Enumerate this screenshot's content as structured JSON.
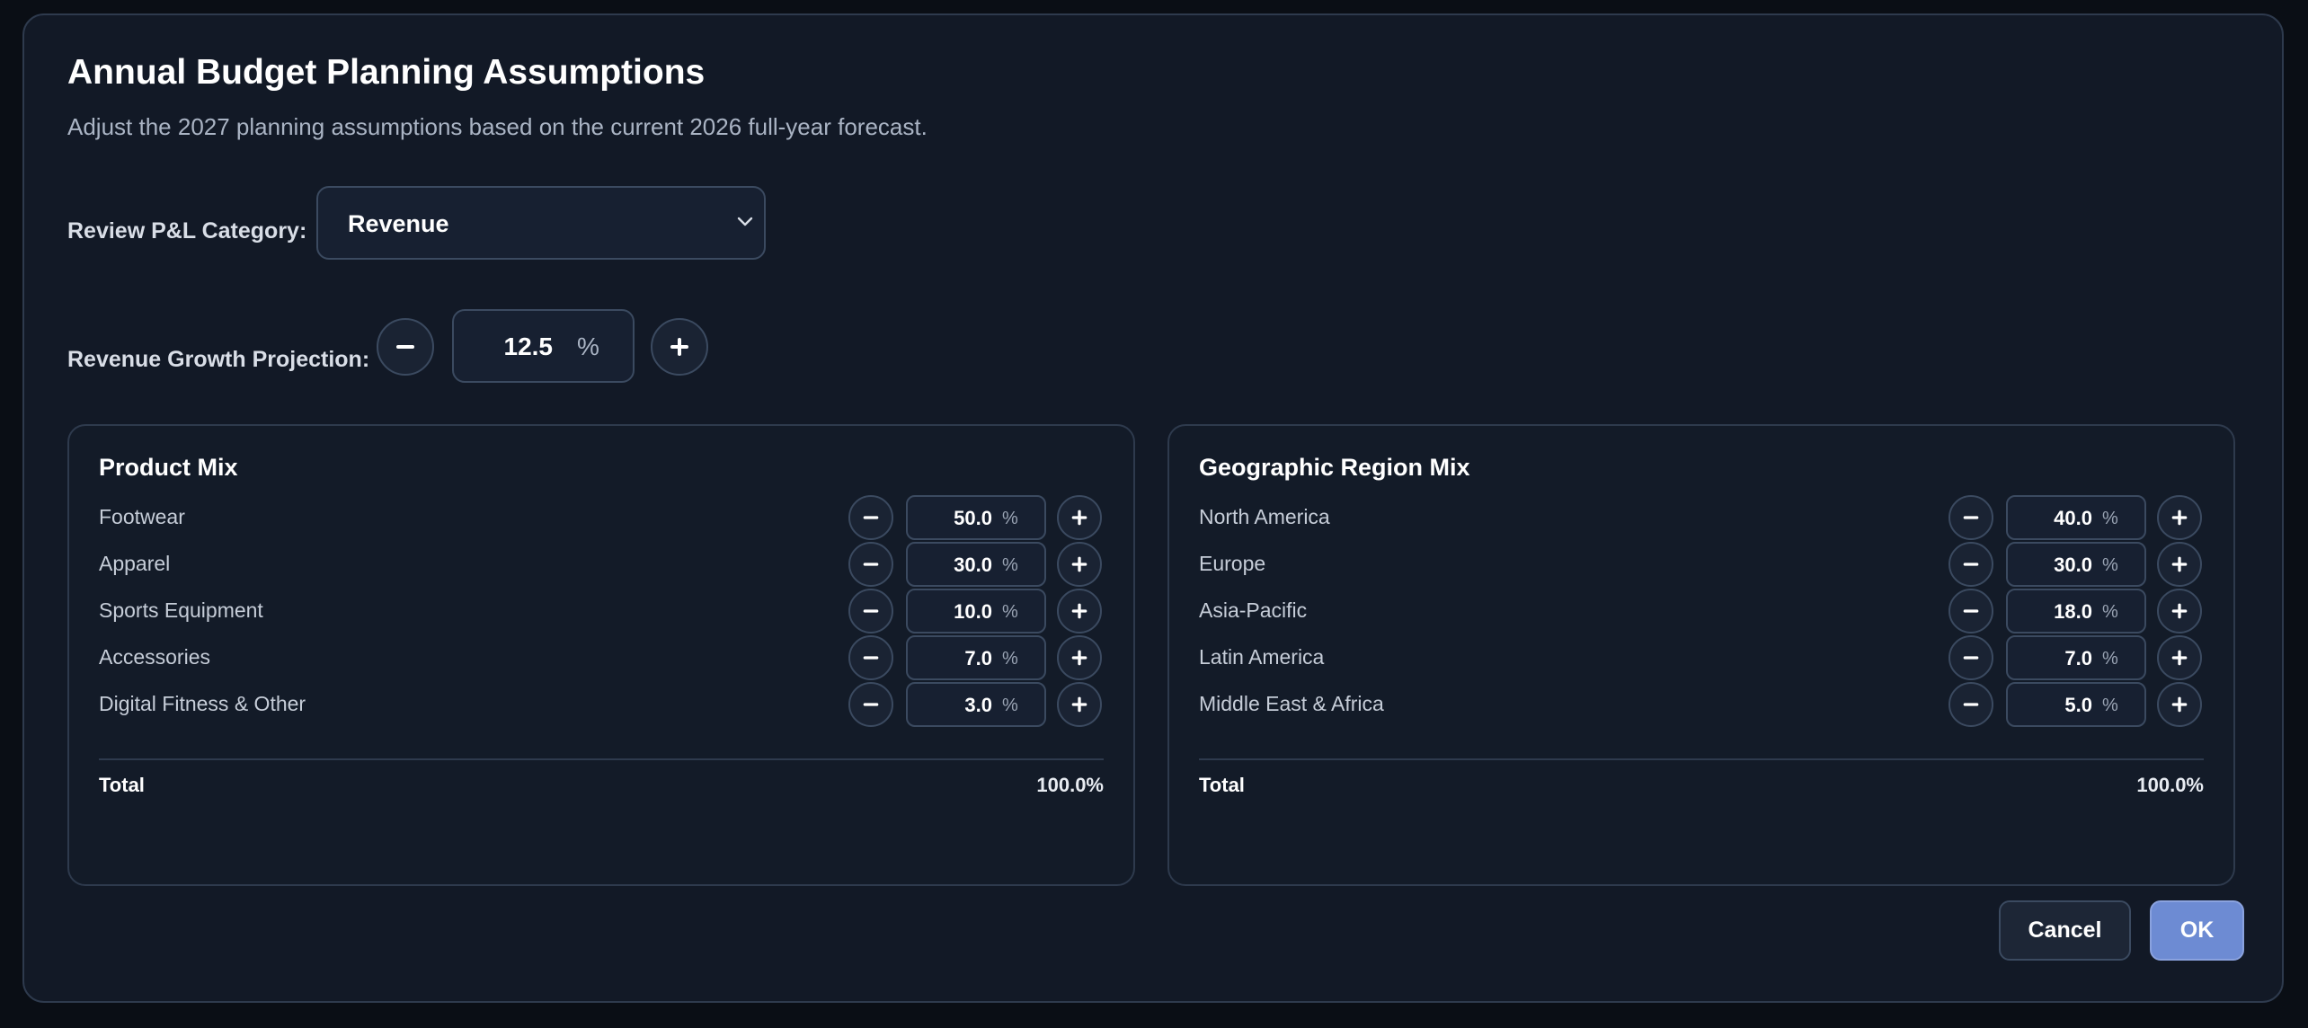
{
  "dialog": {
    "title": "Annual Budget Planning Assumptions",
    "subtitle": "Adjust the 2027 planning assumptions based on the current 2026 full-year forecast."
  },
  "category": {
    "label": "Review P&L Category:",
    "selected": "Revenue",
    "icon": "chevron-down-icon"
  },
  "growth": {
    "label": "Revenue Growth Projection:",
    "value": "12.5",
    "unit": "%"
  },
  "product_mix": {
    "title": "Product Mix",
    "rows": [
      {
        "label": "Footwear",
        "value": "50.0",
        "unit": "%"
      },
      {
        "label": "Apparel",
        "value": "30.0",
        "unit": "%"
      },
      {
        "label": "Sports Equipment",
        "value": "10.0",
        "unit": "%"
      },
      {
        "label": "Accessories",
        "value": "7.0",
        "unit": "%"
      },
      {
        "label": "Digital Fitness & Other",
        "value": "3.0",
        "unit": "%"
      }
    ],
    "total_label": "Total",
    "total_value": "100.0%"
  },
  "region_mix": {
    "title": "Geographic Region Mix",
    "rows": [
      {
        "label": "North America",
        "value": "40.0",
        "unit": "%"
      },
      {
        "label": "Europe",
        "value": "30.0",
        "unit": "%"
      },
      {
        "label": "Asia-Pacific",
        "value": "18.0",
        "unit": "%"
      },
      {
        "label": "Latin America",
        "value": "7.0",
        "unit": "%"
      },
      {
        "label": "Middle East & Africa",
        "value": "5.0",
        "unit": "%"
      }
    ],
    "total_label": "Total",
    "total_value": "100.0%"
  },
  "actions": {
    "cancel": "Cancel",
    "ok": "OK"
  },
  "colors": {
    "background": "#121926",
    "accent": "#6d8bd3",
    "border": "#3b4a60"
  }
}
